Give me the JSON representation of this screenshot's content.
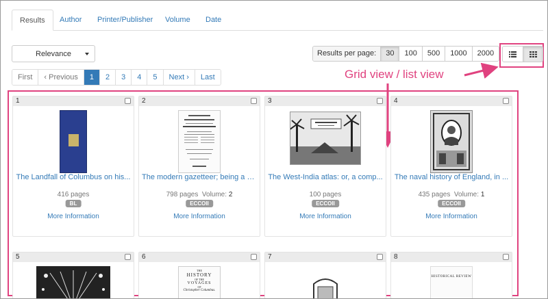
{
  "tabs": [
    "Results",
    "Author",
    "Printer/Publisher",
    "Volume",
    "Date"
  ],
  "sort": {
    "selected": "Relevance"
  },
  "results_per_page": {
    "label": "Results per page:",
    "options": [
      "30",
      "100",
      "500",
      "1000",
      "2000"
    ],
    "selected": "30"
  },
  "view_toggle": {
    "list_icon": "list-icon",
    "grid_icon": "grid-icon",
    "selected": "grid"
  },
  "pagination": {
    "first": "First",
    "previous": "‹ Previous",
    "pages": [
      "1",
      "2",
      "3",
      "4",
      "5"
    ],
    "current": "1",
    "next": "Next ›",
    "last": "Last"
  },
  "annotation": {
    "text": "Grid view / list view",
    "color": "#e0427f"
  },
  "colors": {
    "link": "#337ab7",
    "highlight": "#e0427f",
    "badge": "#999999"
  },
  "results": [
    {
      "num": "1",
      "title": "The Landfall of Columbus on his...",
      "pages": "416 pages",
      "volume_label": "",
      "volume": "",
      "source": "BL",
      "more": "More Information"
    },
    {
      "num": "2",
      "title": "The modern gazetteer; being a c...",
      "pages": "798 pages",
      "volume_label": "Volume:",
      "volume": "2",
      "source": "ECCOII",
      "more": "More Information"
    },
    {
      "num": "3",
      "title": "The West-India atlas: or, a comp...",
      "pages": "100 pages",
      "volume_label": "",
      "volume": "",
      "source": "ECCOII",
      "more": "More Information"
    },
    {
      "num": "4",
      "title": "The naval history of England, in ...",
      "pages": "435 pages",
      "volume_label": "Volume:",
      "volume": "1",
      "source": "ECCOII",
      "more": "More Information"
    },
    {
      "num": "5"
    },
    {
      "num": "6",
      "thumb_text": [
        "THE",
        "HISTORY",
        "OF THE",
        "VOYAGES",
        "OF",
        "Christopher Columbus."
      ]
    },
    {
      "num": "7"
    },
    {
      "num": "8",
      "thumb_text": [
        "HISTORICAL REVIEW"
      ]
    }
  ]
}
